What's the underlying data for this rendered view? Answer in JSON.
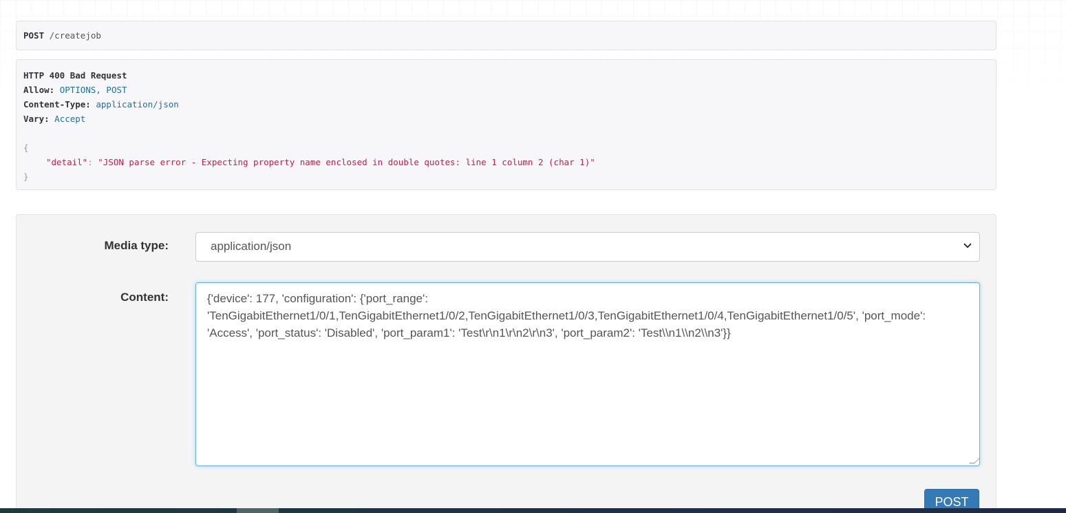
{
  "request": {
    "method": "POST",
    "path": "/createjob"
  },
  "response": {
    "status": "HTTP 400 Bad Request",
    "headers": [
      {
        "name": "Allow:",
        "value": "OPTIONS, POST"
      },
      {
        "name": "Content-Type:",
        "value": "application/json"
      },
      {
        "name": "Vary:",
        "value": "Accept"
      }
    ],
    "open_brace": "{",
    "key": "\"detail\"",
    "colon": ": ",
    "value": "\"JSON parse error - Expecting property name enclosed in double quotes: line 1 column 2 (char 1)\"",
    "close_brace": "}"
  },
  "form": {
    "media_type_label": "Media type:",
    "media_type_value": "application/json",
    "content_label": "Content:",
    "content_value": "{'device': 177, 'configuration': {'port_range':\n'TenGigabitEthernet1/0/1,TenGigabitEthernet1/0/2,TenGigabitEthernet1/0/3,TenGigabitEthernet1/0/4,TenGigabitEthernet1/0/5', 'port_mode':\n'Access', 'port_status': 'Disabled', 'port_param1': 'Test\\r\\n1\\r\\n2\\r\\n3', 'port_param2': 'Test\\\\n1\\\\n2\\\\n3'}}",
    "submit_label": "POST"
  },
  "icons": {
    "select": "chevron-down-icon",
    "resize": "resize-grip-icon"
  },
  "colors": {
    "button": "#337ab7",
    "error_text": "#dd1144",
    "header_value": "#1e6fa0"
  }
}
